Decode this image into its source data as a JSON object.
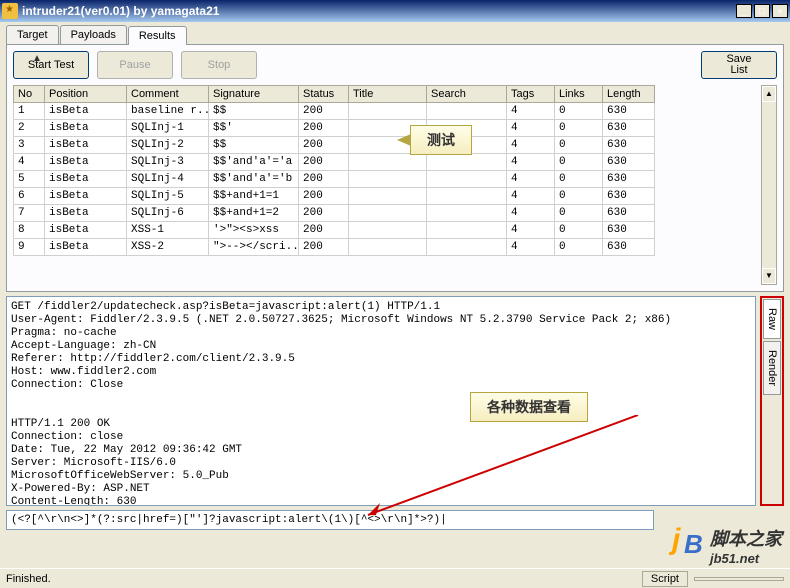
{
  "window": {
    "title": "intruder21(ver0.01) by yamagata21"
  },
  "tabs": [
    {
      "label": "Target",
      "active": false
    },
    {
      "label": "Payloads",
      "active": false
    },
    {
      "label": "Results",
      "active": true
    }
  ],
  "toolbar": {
    "start": "Start Test",
    "pause": "Pause",
    "stop": "Stop",
    "savelist": "Save\nList"
  },
  "grid": {
    "headers": [
      "No",
      "Position",
      "Comment",
      "Signature",
      "Status",
      "Title",
      "Search",
      "Tags",
      "Links",
      "Length"
    ],
    "rows": [
      [
        "1",
        "isBeta",
        "baseline r...",
        "$$",
        "200",
        "",
        "",
        "4",
        "0",
        "630"
      ],
      [
        "2",
        "isBeta",
        "SQLInj-1",
        "$$'",
        "200",
        "",
        "",
        "4",
        "0",
        "630"
      ],
      [
        "3",
        "isBeta",
        "SQLInj-2",
        "$$",
        "200",
        "",
        "",
        "4",
        "0",
        "630"
      ],
      [
        "4",
        "isBeta",
        "SQLInj-3",
        "$$'and'a'='a",
        "200",
        "",
        "",
        "4",
        "0",
        "630"
      ],
      [
        "5",
        "isBeta",
        "SQLInj-4",
        "$$'and'a'='b",
        "200",
        "",
        "",
        "4",
        "0",
        "630"
      ],
      [
        "6",
        "isBeta",
        "SQLInj-5",
        "$$+and+1=1",
        "200",
        "",
        "",
        "4",
        "0",
        "630"
      ],
      [
        "7",
        "isBeta",
        "SQLInj-6",
        "$$+and+1=2",
        "200",
        "",
        "",
        "4",
        "0",
        "630"
      ],
      [
        "8",
        "isBeta",
        "XSS-1",
        "'>\"><s>xss",
        "200",
        "",
        "",
        "4",
        "0",
        "630"
      ],
      [
        "9",
        "isBeta",
        "XSS-2",
        "\">--></scri...",
        "200",
        "",
        "",
        "4",
        "0",
        "630"
      ]
    ]
  },
  "callouts": {
    "test": "测试",
    "dataview": "各种数据查看"
  },
  "vtabs": {
    "raw": "Raw",
    "render": "Render"
  },
  "raw_text": "GET /fiddler2/updatecheck.asp?isBeta=javascript:alert(1) HTTP/1.1\nUser-Agent: Fiddler/2.3.9.5 (.NET 2.0.50727.3625; Microsoft Windows NT 5.2.3790 Service Pack 2; x86)\nPragma: no-cache\nAccept-Language: zh-CN\nReferer: http://fiddler2.com/client/2.3.9.5\nHost: www.fiddler2.com\nConnection: Close\n\n\nHTTP/1.1 200 OK\nConnection: close\nDate: Tue, 22 May 2012 09:36:42 GMT\nServer: Microsoft-IIS/6.0\nMicrosoftOfficeWebServer: 5.0_Pub\nX-Powered-By: ASP.NET\nContent-Length: 630",
  "search_value": "(<?[^\\r\\n<>]*(?:src|href=)[\"']?javascript:alert\\(1\\)[^<>\\r\\n]*>?)|",
  "status": {
    "text": "Finished.",
    "script": "Script"
  },
  "watermark": {
    "cn": "脚本之家",
    "url": "jb51.net"
  }
}
